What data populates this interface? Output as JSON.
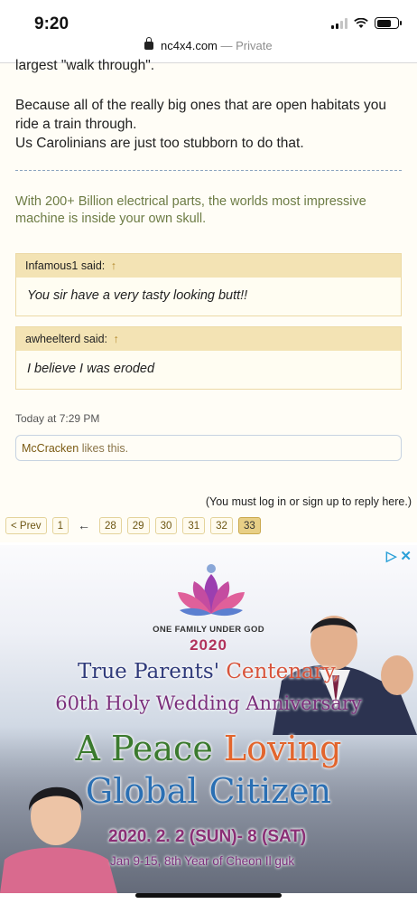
{
  "status_bar": {
    "time": "9:20"
  },
  "browser": {
    "domain": "nc4x4.com",
    "mode": "— Private"
  },
  "post": {
    "partial_line": "largest \"walk through\".",
    "text_line1": "Because all of the really big ones that are open habitats you ride a train through.",
    "text_line2": "Us Carolinians are just too stubborn to do that.",
    "signature": "With 200+ Billion electrical parts, the worlds most impressive machine is inside your own skull.",
    "quotes": [
      {
        "author": "Infamous1 said:",
        "arrow": "↑",
        "text": "You sir have a very tasty looking butt!!"
      },
      {
        "author": "awheelterd said:",
        "arrow": "↑",
        "text": "I believe I was eroded"
      }
    ],
    "date": "Today at 7:29 PM",
    "likes": {
      "user": "McCracken",
      "rest": " likes this."
    }
  },
  "reply_note": "(You must log in or sign up to reply here.)",
  "pagination": {
    "prev": "< Prev",
    "first": "1",
    "skip": "←",
    "pages": [
      "28",
      "29",
      "30",
      "31",
      "32"
    ],
    "current": "33"
  },
  "ad": {
    "choices_icons": [
      "ad-choices-icon",
      "close-icon"
    ],
    "org_name": "ONE FAMILY UNDER GOD",
    "org_year": "2020",
    "line1_a": "True Parents' ",
    "line1_b": "Centenary,",
    "line2": "60th Holy Wedding Anniversary",
    "line3_a": "A Peace ",
    "line3_b": "Loving",
    "line4": "Global Citizen",
    "date1": "2020. 2. 2 (SUN)- 8 (SAT)",
    "date2": "Jan 9-15, 8th Year of Cheon Il guk"
  },
  "colors": {
    "link": "#7b5b12",
    "signature": "#6d7c45",
    "quote_header": "#f3e3b4",
    "current_page": "#e8cf86"
  }
}
